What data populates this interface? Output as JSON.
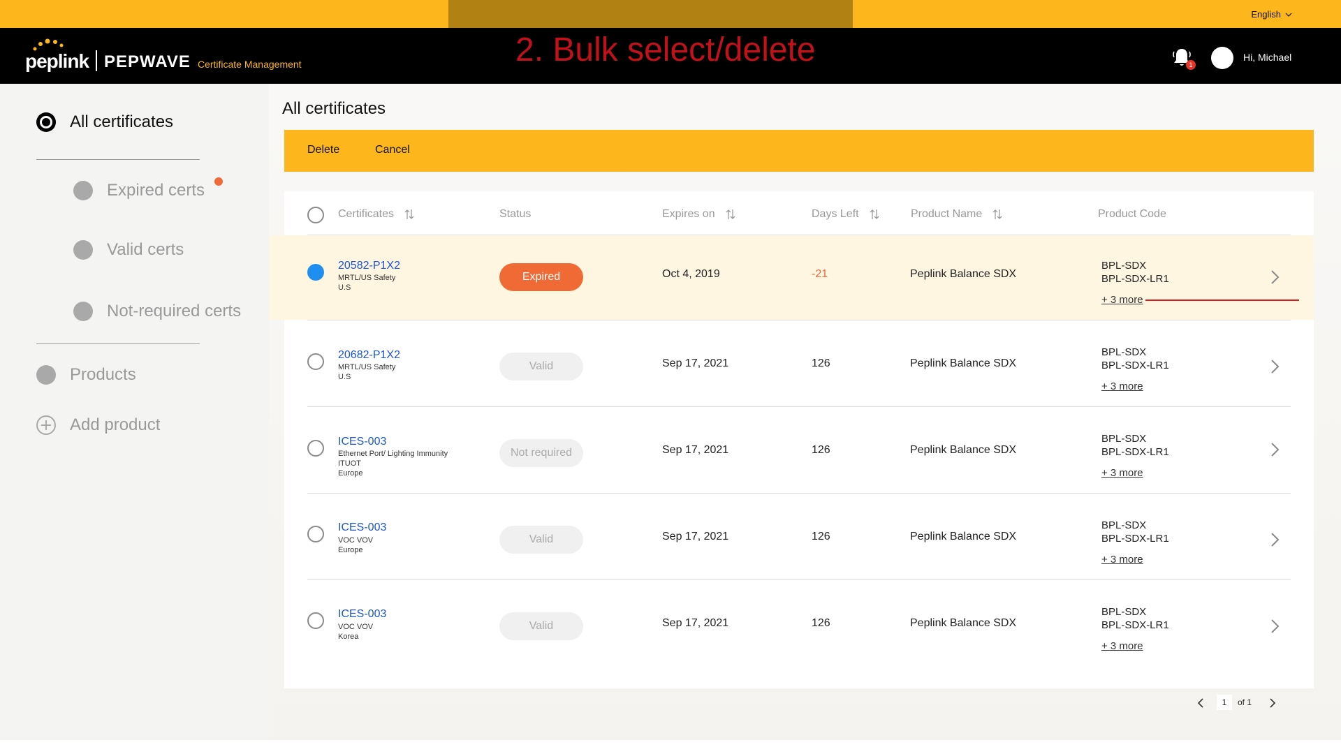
{
  "topbar": {
    "language": "English"
  },
  "header": {
    "brand_peplink": "peplink",
    "brand_pepwave": "PEPWAVE",
    "app_name": "Certificate Management",
    "banner": "2. Bulk select/delete",
    "notification_count": "1",
    "greeting": "Hi, Michael"
  },
  "sidebar": {
    "all_certificates": "All certificates",
    "expired_certs": "Expired certs",
    "valid_certs": "Valid certs",
    "not_required_certs": "Not-required certs",
    "products": "Products",
    "add_product": "Add product"
  },
  "main": {
    "title": "All certificates",
    "actions": {
      "delete": "Delete",
      "cancel": "Cancel"
    },
    "columns": {
      "certificates": "Certificates",
      "status": "Status",
      "expires_on": "Expires on",
      "days_left": "Days Left",
      "product_name": "Product Name",
      "product_code": "Product Code"
    },
    "rows": [
      {
        "selected": true,
        "cert": "20582-P1X2",
        "sub1": "MRTL/US Safety",
        "sub2": "U.S",
        "sub3": "",
        "status": "Expired",
        "expires": "Oct 4, 2019",
        "days": "-21",
        "product": "Peplink Balance SDX",
        "code1": "BPL-SDX",
        "code2": "BPL-SDX-LR1",
        "more": "+ 3 more"
      },
      {
        "selected": false,
        "cert": "20682-P1X2",
        "sub1": "MRTL/US Safety",
        "sub2": "U.S",
        "sub3": "",
        "status": "Valid",
        "expires": "Sep 17, 2021",
        "days": "126",
        "product": "Peplink Balance SDX",
        "code1": "BPL-SDX",
        "code2": "BPL-SDX-LR1",
        "more": "+ 3 more"
      },
      {
        "selected": false,
        "cert": "ICES-003",
        "sub1": "Ethernet Port/ Lighting Immunity",
        "sub2": "ITUOT",
        "sub3": "Europe",
        "status": "Not required",
        "expires": "Sep 17, 2021",
        "days": "126",
        "product": "Peplink Balance SDX",
        "code1": "BPL-SDX",
        "code2": "BPL-SDX-LR1",
        "more": "+ 3 more"
      },
      {
        "selected": false,
        "cert": "ICES-003",
        "sub1": "VOC VOV",
        "sub2": "Europe",
        "sub3": "",
        "status": "Valid",
        "expires": "Sep 17, 2021",
        "days": "126",
        "product": "Peplink Balance SDX",
        "code1": "BPL-SDX",
        "code2": "BPL-SDX-LR1",
        "more": "+ 3 more"
      },
      {
        "selected": false,
        "cert": "ICES-003",
        "sub1": "VOC VOV",
        "sub2": "Korea",
        "sub3": "",
        "status": "Valid",
        "expires": "Sep 17, 2021",
        "days": "126",
        "product": "Peplink Balance SDX",
        "code1": "BPL-SDX",
        "code2": "BPL-SDX-LR1",
        "more": "+ 3 more"
      }
    ]
  },
  "pagination": {
    "page": "1",
    "of_label": "of 1"
  },
  "colors": {
    "accent": "#fdb61b",
    "expired": "#f06a36",
    "link": "#1a55d6",
    "selected": "#1f8ef1",
    "banner": "#c3111a"
  }
}
